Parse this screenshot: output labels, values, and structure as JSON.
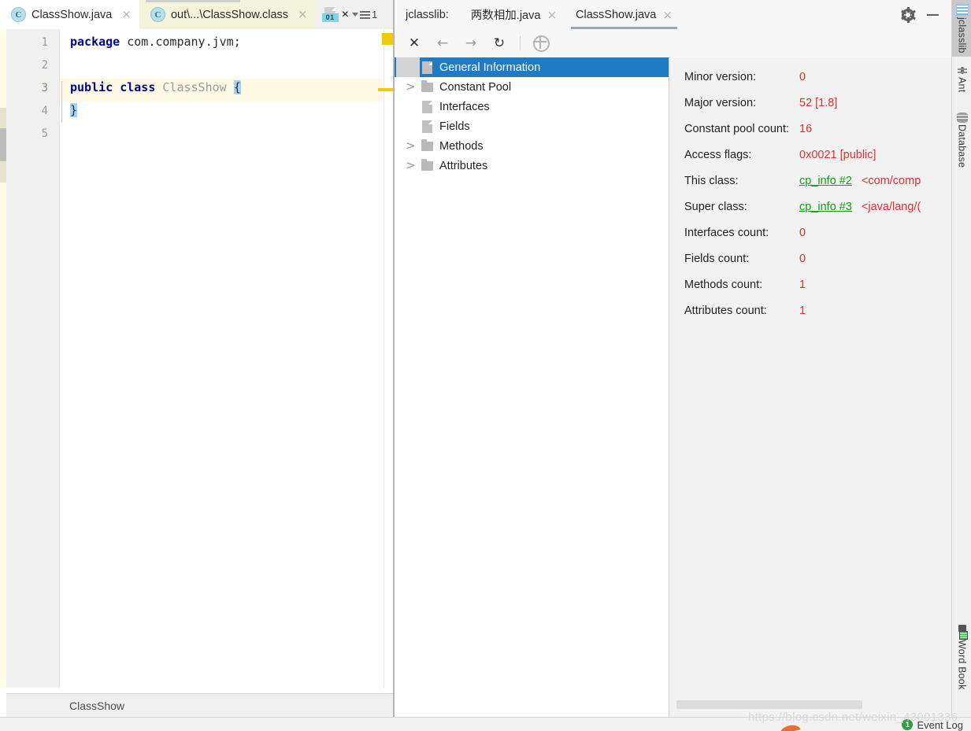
{
  "editor": {
    "tabs": [
      {
        "label": "ClassShow.java",
        "icon": "java-class-icon",
        "state": "active"
      },
      {
        "label": "out\\...\\ClassShow.class",
        "icon": "java-class-icon",
        "state": "classfile"
      }
    ],
    "extra": {
      "binary_icon_label": "01",
      "close_label": "×",
      "stack_count": "1"
    },
    "close_label": "×",
    "gutter_lines": [
      "1",
      "2",
      "3",
      "4",
      "5"
    ],
    "code": {
      "line1_kw": "package",
      "line1_rest": " com.company.jvm;",
      "line3_kw1": "public",
      "line3_kw2": "class",
      "line3_name": "ClassShow",
      "line3_brace": "{",
      "line4_brace": "}"
    },
    "breadcrumb": "ClassShow"
  },
  "tool": {
    "title": "jclasslib:",
    "tabs": [
      {
        "label": "两数相加.java",
        "state": "inactive"
      },
      {
        "label": "ClassShow.java",
        "state": "active"
      }
    ],
    "close_label": "×",
    "window_controls": [
      "gear-icon",
      "minimize-icon"
    ],
    "toolbar": {
      "close": "✕",
      "back": "←",
      "forward": "→",
      "reload": "↻",
      "browse": "globe-icon"
    },
    "tree": [
      {
        "label": "General Information",
        "icon": "file-icon",
        "expandable": false,
        "selected": true
      },
      {
        "label": "Constant Pool",
        "icon": "folder-icon",
        "expandable": true,
        "selected": false
      },
      {
        "label": "Interfaces",
        "icon": "file-icon",
        "expandable": false,
        "selected": false
      },
      {
        "label": "Fields",
        "icon": "file-icon",
        "expandable": false,
        "selected": false
      },
      {
        "label": "Methods",
        "icon": "folder-icon",
        "expandable": true,
        "selected": false
      },
      {
        "label": "Attributes",
        "icon": "folder-icon",
        "expandable": true,
        "selected": false
      }
    ],
    "detail": [
      {
        "label": "Minor version:",
        "value": "0",
        "link": ""
      },
      {
        "label": "Major version:",
        "value": "52 [1.8]",
        "link": ""
      },
      {
        "label": "Constant pool count:",
        "value": "16",
        "link": ""
      },
      {
        "label": "Access flags:",
        "value": "0x0021 [public]",
        "link": ""
      },
      {
        "label": "This class:",
        "value": "<com/comp",
        "link": "cp_info #2"
      },
      {
        "label": "Super class:",
        "value": "<java/lang/(",
        "link": "cp_info #3"
      },
      {
        "label": "Interfaces count:",
        "value": "0",
        "link": ""
      },
      {
        "label": "Fields count:",
        "value": "0",
        "link": ""
      },
      {
        "label": "Methods count:",
        "value": "1",
        "link": ""
      },
      {
        "label": "Attributes count:",
        "value": "1",
        "link": ""
      }
    ]
  },
  "rail": {
    "top_items": [
      {
        "label": "jclasslib",
        "icon": "jclasslib-icon",
        "active": true
      },
      {
        "label": "Ant",
        "icon": "ant-icon",
        "active": false
      },
      {
        "label": "Database",
        "icon": "database-icon",
        "active": false
      }
    ],
    "bottom_items": [
      {
        "label": "Word Book",
        "icon": "word-book-icon",
        "active": false
      }
    ]
  },
  "statusbar": {
    "event_log_label": "Event Log",
    "event_log_count": "1",
    "watermark": "https://blog.csdn.net/weixin_43001336"
  },
  "colors": {
    "selection_blue": "#1f7cc4",
    "value_red": "#e03030",
    "link_green": "#12a012",
    "keyword_blue": "#00008c",
    "marker_yellow": "#f0cb00",
    "badge_green": "#2f9e44"
  }
}
